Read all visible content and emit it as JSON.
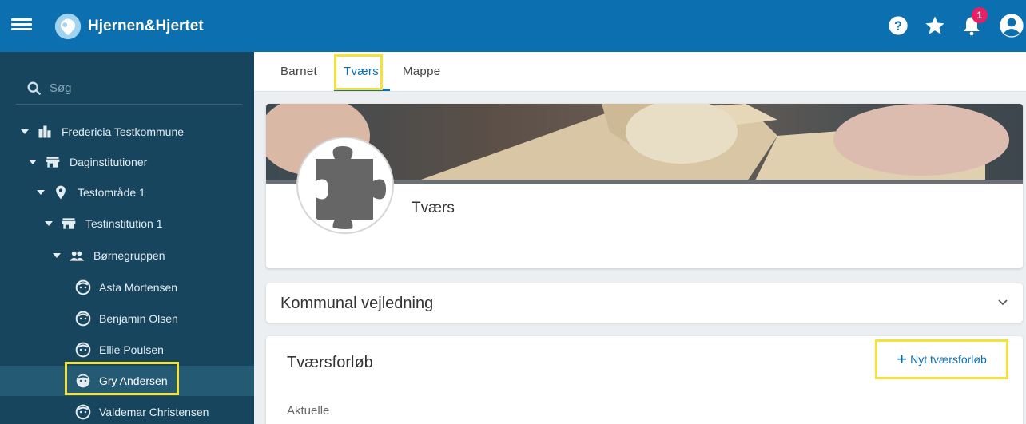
{
  "app": {
    "title": "Hjernen&Hjertet",
    "notification_count": "1"
  },
  "colors": {
    "topbar": "#0b6fb0",
    "sidebar": "#17455e",
    "highlight": "#f5e13c",
    "accent": "#0b6fb0"
  },
  "icons": {
    "menu": "menu-icon",
    "help": "help-icon",
    "favorites": "star-icon",
    "notifications": "bell-icon",
    "account": "account-icon",
    "search": "search-icon"
  },
  "sidebar": {
    "search_placeholder": "Søg",
    "tree": [
      {
        "label": "Fredericia Testkommune",
        "icon": "city-icon",
        "expanded": true
      },
      {
        "label": "Daginstitutioner",
        "icon": "store-icon",
        "expanded": true
      },
      {
        "label": "Testområde 1",
        "icon": "location-pin-icon",
        "expanded": true
      },
      {
        "label": "Testinstitution 1",
        "icon": "store-icon",
        "expanded": true
      },
      {
        "label": "Børnegruppen",
        "icon": "group-icon",
        "expanded": true
      },
      {
        "label": "Asta Mortensen",
        "icon": "child-face-icon"
      },
      {
        "label": "Benjamin Olsen",
        "icon": "child-face-icon"
      },
      {
        "label": "Ellie Poulsen",
        "icon": "child-face-icon"
      },
      {
        "label": "Gry Andersen",
        "icon": "child-face-icon",
        "selected": true
      },
      {
        "label": "Valdemar Christensen",
        "icon": "child-face-icon"
      }
    ]
  },
  "tabs": [
    {
      "label": "Barnet",
      "active": false
    },
    {
      "label": "Tværs",
      "active": true
    },
    {
      "label": "Mappe",
      "active": false
    }
  ],
  "profile": {
    "title": "Tværs"
  },
  "accordion": {
    "title": "Kommunal vejledning"
  },
  "tvaersforloeb": {
    "title": "Tværsforløb",
    "new_button_label": "Nyt tværsforløb",
    "section_label": "Aktuelle"
  }
}
